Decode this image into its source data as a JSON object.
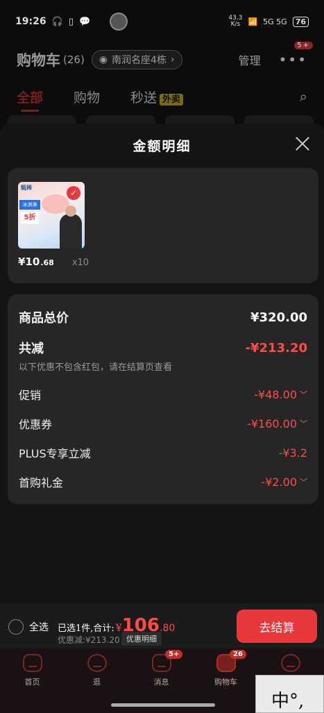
{
  "status": {
    "time": "19:26",
    "left_icons": "🎧 ▯ 💬",
    "net_speed_value": "43.3",
    "net_speed_unit": "K/s",
    "signal": "5G 5G",
    "battery": "76"
  },
  "header": {
    "title": "购物车",
    "count": "(26)",
    "address": "南润名座4栋",
    "manage": "管理",
    "more_badge": "5+"
  },
  "tabs": {
    "all": "全部",
    "shopping": "购物",
    "flash": "秒送",
    "flash_badge": "外卖"
  },
  "sheet": {
    "title": "金额明细",
    "product": {
      "brand": "甄稀",
      "tag": "冰淇淋",
      "off": "5折",
      "price_int": "¥10",
      "price_dec": ".68",
      "qty": "x10"
    },
    "details": {
      "total_label": "商品总价",
      "total_value": "¥320.00",
      "discount_label": "共减",
      "discount_value": "-¥213.20",
      "note": "以下优惠不包含红包，请在结算页查看",
      "rows": [
        {
          "label": "促销",
          "value": "-¥48.00"
        },
        {
          "label": "优惠券",
          "value": "-¥160.00"
        },
        {
          "label": "PLUS专享立减",
          "value": "-¥3.2"
        },
        {
          "label": "首购礼金",
          "value": "-¥2.00"
        }
      ]
    }
  },
  "checkout": {
    "select_all": "全选",
    "selected_text": "已选1件,合计:",
    "currency": "¥",
    "total_int": "106",
    "total_dec": ".80",
    "saved": "优惠减:¥213.20",
    "detail_chip": "优惠明细",
    "button": "去结算"
  },
  "nav": {
    "items": [
      {
        "label": "首页",
        "badge": ""
      },
      {
        "label": "逛",
        "badge": ""
      },
      {
        "label": "消息",
        "badge": "5+"
      },
      {
        "label": "购物车",
        "badge": "26"
      },
      {
        "label": "",
        "badge": ""
      }
    ]
  },
  "popup_text": "中°,"
}
